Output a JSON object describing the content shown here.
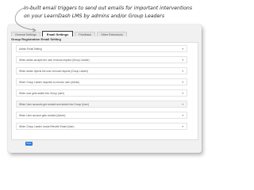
{
  "caption": {
    "line1": "In-built email triggers to send out emails for important interventions",
    "line2": "on your LearnDash LMS by admins and/or Group Leaders"
  },
  "tabs": [
    {
      "label": "General Settings",
      "active": false
    },
    {
      "label": "Email Settings",
      "active": true
    },
    {
      "label": "Feedback",
      "active": false
    },
    {
      "label": "Other Extensions",
      "active": false
    }
  ],
  "section_title": "Group Registration Email Setting",
  "rows": [
    {
      "label": "Admin Email Setting",
      "highlight": false
    },
    {
      "label": "When admin accepts the user removal request (Group Leader)",
      "highlight": false
    },
    {
      "label": "When admin rejects the user removal request (Group Leader)",
      "highlight": false
    },
    {
      "label": "When Group Leader requests to remove user (Admin)",
      "highlight": false
    },
    {
      "label": "When user gets added into Group (user)",
      "highlight": false
    },
    {
      "label": "When User accounts get created and added into Group (User)",
      "highlight": true
    },
    {
      "label": "When User account gets created (Admin)",
      "highlight": false
    },
    {
      "label": "When Group Leader Leads Reinvite Email (User)",
      "highlight": false
    }
  ],
  "save_label": "Save",
  "icons": {
    "row_toggle": "chevron-down-icon"
  },
  "colors": {
    "accent": "#2b7bd8",
    "card_background": "#f1f1f1"
  }
}
